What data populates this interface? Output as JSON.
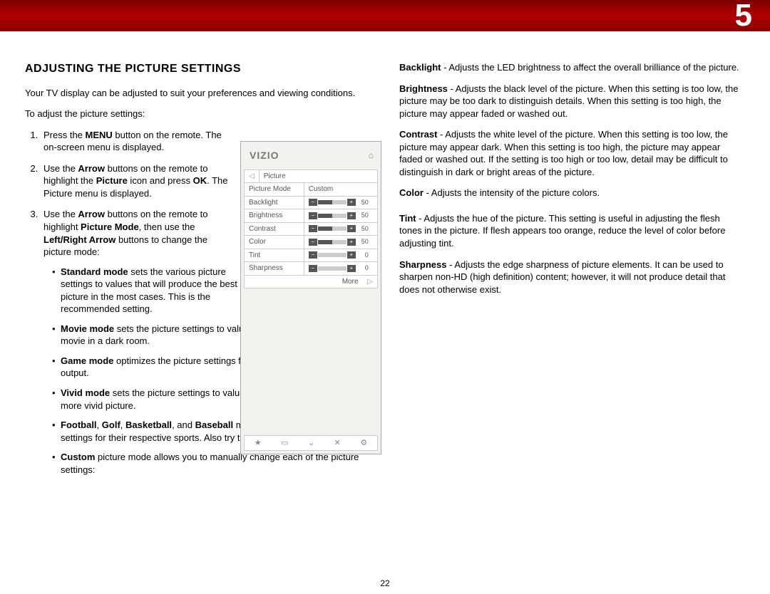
{
  "chapter": "5",
  "page_number": "22",
  "heading": "ADJUSTING THE PICTURE SETTINGS",
  "intro": "Your TV display can be adjusted to suit your preferences and viewing conditions.",
  "lead": "To adjust the picture settings:",
  "steps": {
    "s1a": "Press the ",
    "s1b": "MENU",
    "s1c": " button on the remote. The on-screen menu is displayed.",
    "s2a": "Use the ",
    "s2b": "Arrow",
    "s2c": " buttons on the remote to highlight the ",
    "s2d": "Picture",
    "s2e": " icon and press ",
    "s2f": "OK",
    "s2g": ". The Picture menu is displayed.",
    "s3a": "Use the ",
    "s3b": "Arrow",
    "s3c": " buttons on the remote to highlight ",
    "s3d": "Picture Mode",
    "s3e": ", then use the ",
    "s3f": "Left/Right Arrow",
    "s3g": " buttons to change the picture mode:"
  },
  "modes": {
    "m1a": "Standard mode",
    "m1b": " sets the various picture settings to values that will produce the best picture in the most cases. This is the recommended setting.",
    "m2a": "Movie mode",
    "m2b": " sets the picture settings to values perfect for watching a movie in a dark room.",
    "m3a": "Game mode",
    "m3b": " optimizes the picture settings for displaying game console output.",
    "m4a": "Vivid mode",
    "m4b": " sets the picture settings to values that produce a brighter, more vivid picture.",
    "m5a": "Football",
    "m5b": ", ",
    "m5c": "Golf",
    "m5d": ", ",
    "m5e": "Basketball",
    "m5f": ", and ",
    "m5g": "Baseball",
    "m5h": " modes optimize the picture settings for their respective sports. Also try these modes for other sports.",
    "m6a": "Custom",
    "m6b": " picture mode allows you to manually change each of the picture settings:"
  },
  "defs": {
    "d1a": "Backlight",
    "d1b": " - Adjusts the LED brightness to affect the overall brilliance of the picture.",
    "d2a": "Brightness",
    "d2b": " - Adjusts the black level of the picture. When this setting is too low, the picture may be too dark to distinguish details. When this setting is too high, the picture may appear faded or washed out.",
    "d3a": "Contrast",
    "d3b": " - Adjusts the white level of the picture. When this setting is too low, the picture may appear dark. When this setting is too high, the picture may appear faded or washed out. If the setting is too high or too low, detail may be difficult to distinguish in dark or bright areas of the picture.",
    "d4a": "Color",
    "d4b": " - Adjusts the intensity of the picture colors.",
    "d5a": "Tint",
    "d5b": " - Adjusts the hue of the picture. This setting is useful in adjusting the flesh tones in the picture. If flesh appears too orange, reduce the level of color before adjusting tint.",
    "d6a": "Sharpness",
    "d6b": " - Adjusts the edge sharpness of picture elements. It can be used to sharpen non-HD (high definition) content; however, it will not produce detail that does not otherwise exist."
  },
  "osd": {
    "logo": "VIZIO",
    "back": "◁",
    "title": "Picture",
    "rows": [
      {
        "label": "Picture Mode",
        "type": "text",
        "value": "Custom"
      },
      {
        "label": "Backlight",
        "type": "slider",
        "fill": 50,
        "value": "50"
      },
      {
        "label": "Brightness",
        "type": "slider",
        "fill": 50,
        "value": "50"
      },
      {
        "label": "Contrast",
        "type": "slider",
        "fill": 50,
        "value": "50"
      },
      {
        "label": "Color",
        "type": "slider",
        "fill": 50,
        "value": "50"
      },
      {
        "label": "Tint",
        "type": "slider",
        "fill": 0,
        "value": "0"
      },
      {
        "label": "Sharpness",
        "type": "slider",
        "fill": 0,
        "value": "0"
      }
    ],
    "more": "More",
    "more_arrow": "▷",
    "footer_icons": [
      "★",
      "▭",
      "⌄",
      "✕",
      "⚙"
    ]
  }
}
